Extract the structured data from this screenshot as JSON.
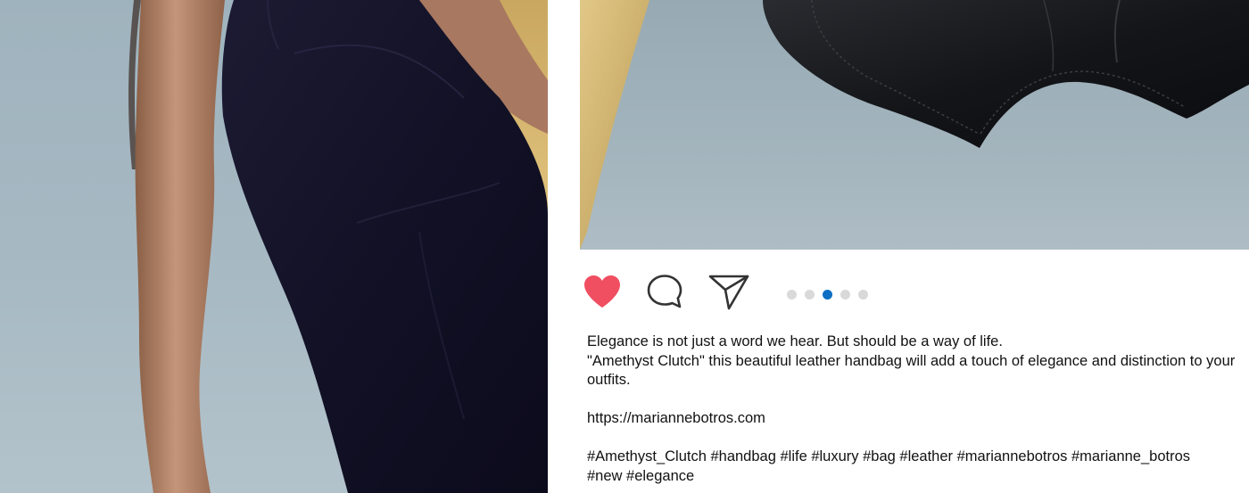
{
  "post": {
    "images": [
      {
        "name": "model-in-black-dress-photo",
        "colors": {
          "background": "#a7b9c3",
          "dress": "#15142a",
          "skin": "#b98a6a",
          "accent": "#d9b96e"
        }
      },
      {
        "name": "black-leather-clutch-photo",
        "colors": {
          "background": "#a3b4bd",
          "clutch": "#141519",
          "accent": "#d8bd7a"
        }
      }
    ],
    "actions": {
      "like_icon": "heart-icon",
      "like_color": "#f04e61",
      "comment_icon": "speech-bubble-icon",
      "share_icon": "paper-plane-icon"
    },
    "carousel": {
      "count": 5,
      "active_index": 2,
      "active_color": "#0e6fc4",
      "inactive_color": "#d9d9d9"
    },
    "caption": {
      "line1": "Elegance is not just a word we hear. But should be a way of life.",
      "line2": "\"Amethyst Clutch\" this beautiful leather handbag will add a touch of elegance and distinction to your",
      "line3": "outfits.",
      "link": "https://mariannebotros.com",
      "hashtags_line1": "#Amethyst_Clutch #handbag #life #luxury #bag #leather #mariannebotros #marianne_botros",
      "hashtags_line2": "#new #elegance"
    }
  }
}
